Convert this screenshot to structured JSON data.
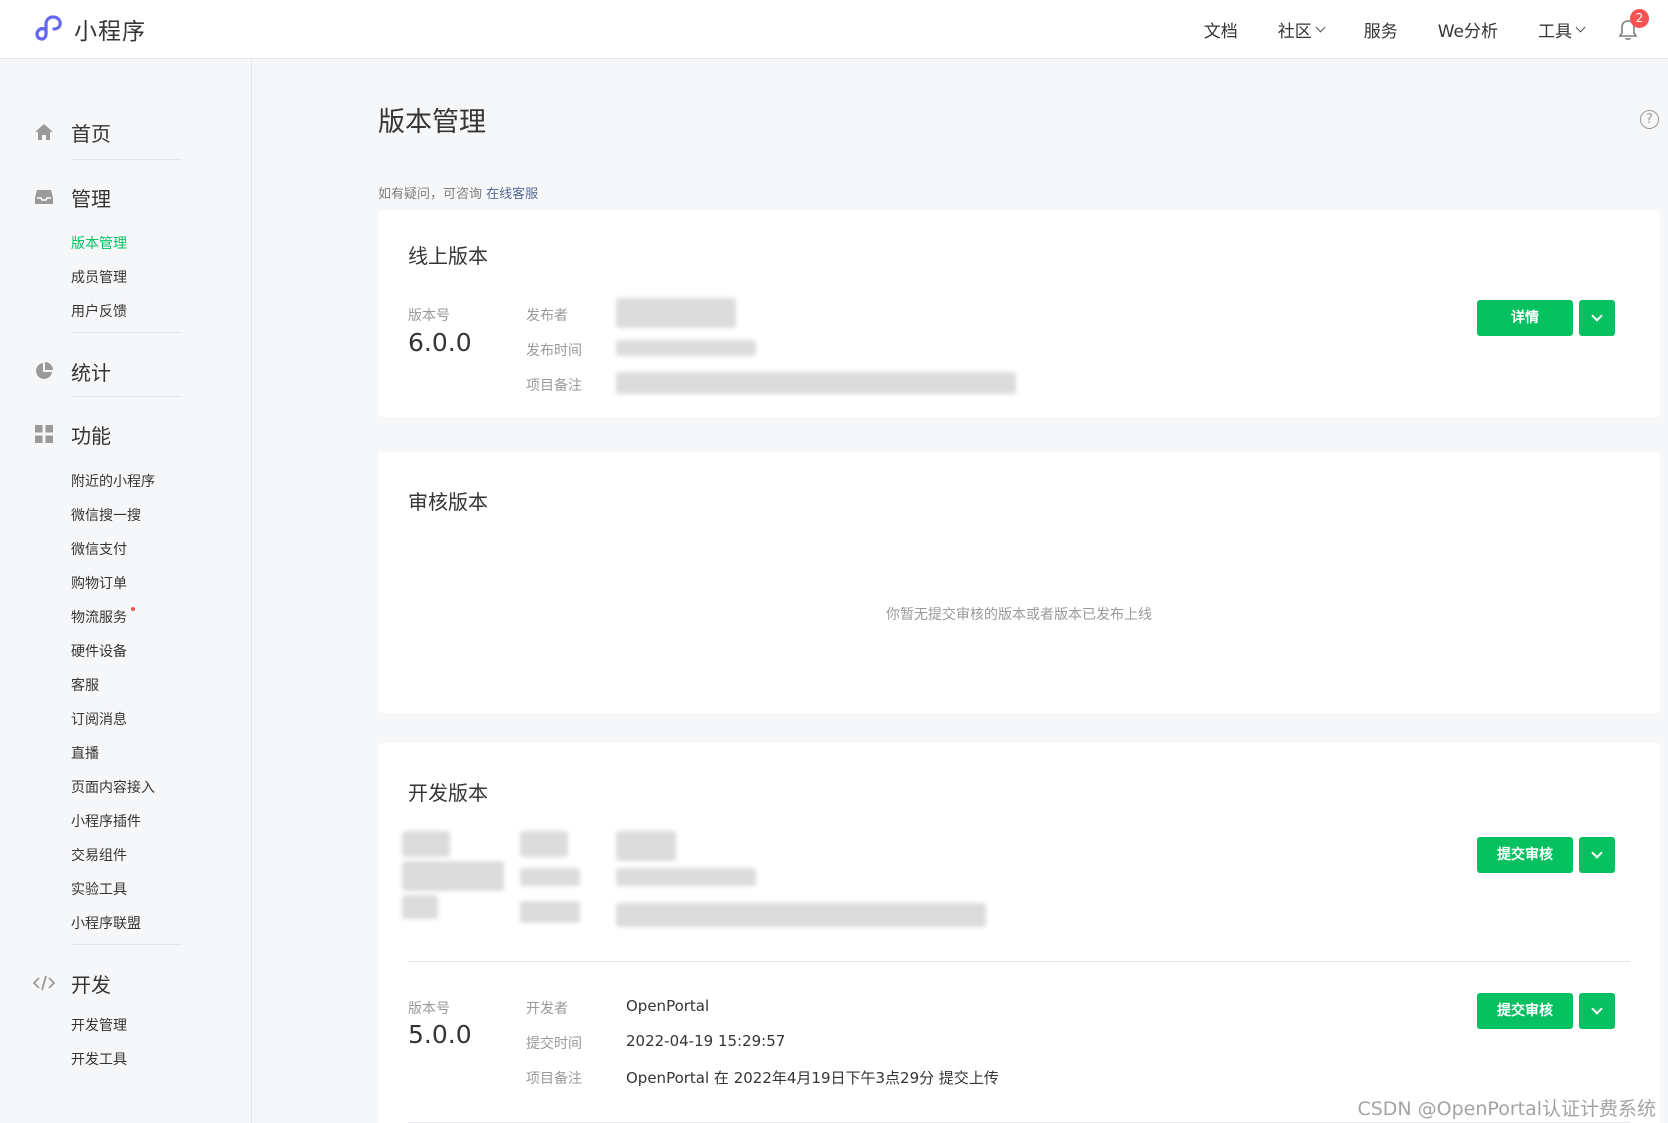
{
  "app": {
    "title": "小程序"
  },
  "topnav": {
    "docs": "文档",
    "community": "社区",
    "service": "服务",
    "analytics": "We分析",
    "tools": "工具",
    "notification_count": "2"
  },
  "sidebar": {
    "home": "首页",
    "manage": "管理",
    "manage_items": [
      "版本管理",
      "成员管理",
      "用户反馈"
    ],
    "stats": "统计",
    "features": "功能",
    "feature_items": [
      "附近的小程序",
      "微信搜一搜",
      "微信支付",
      "购物订单",
      "物流服务",
      "硬件设备",
      "客服",
      "订阅消息",
      "直播",
      "页面内容接入",
      "小程序插件",
      "交易组件",
      "实验工具",
      "小程序联盟"
    ],
    "dev": "开发",
    "dev_items": [
      "开发管理",
      "开发工具"
    ]
  },
  "main": {
    "title": "版本管理",
    "help": "?",
    "consult_prefix": "如有疑问，可咨询 ",
    "consult_link": "在线客服",
    "online": {
      "title": "线上版本",
      "version_label": "版本号",
      "version": "6.0.0",
      "publisher_label": "发布者",
      "time_label": "发布时间",
      "note_label": "项目备注",
      "detail_button": "详情"
    },
    "review": {
      "title": "审核版本",
      "empty": "你暂无提交审核的版本或者版本已发布上线"
    },
    "dev": {
      "title": "开发版本",
      "submit_button": "提交审核",
      "version_label": "版本号",
      "version": "5.0.0",
      "developer_label": "开发者",
      "developer": "OpenPortal",
      "time_label": "提交时间",
      "time": "2022-04-19 15:29:57",
      "note_label": "项目备注",
      "note": "OpenPortal 在 2022年4月19日下午3点29分 提交上传"
    }
  },
  "watermark": "CSDN @OpenPortal认证计费系统",
  "colors": {
    "accent": "#07c160",
    "link": "#576b95",
    "badge": "#fa5151"
  }
}
